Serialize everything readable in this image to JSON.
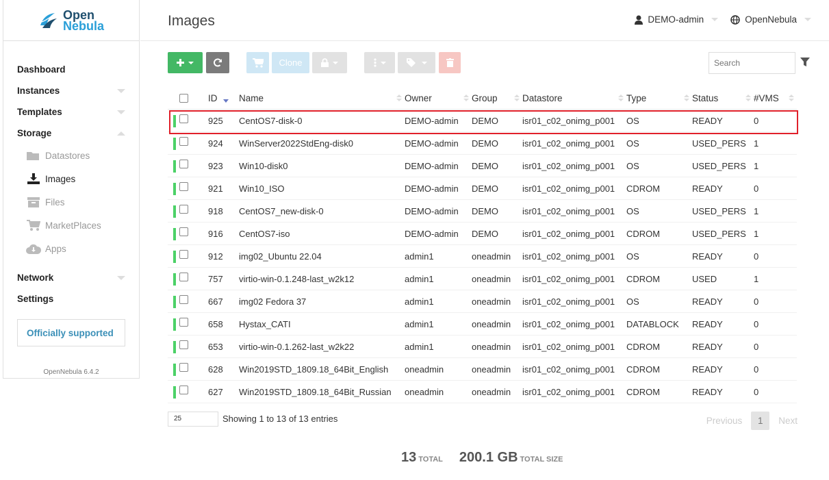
{
  "app": {
    "logo_line1": "Open",
    "logo_line2": "Nebula",
    "version": "OpenNebula 6.4.2"
  },
  "sidebar": {
    "items": [
      {
        "label": "Dashboard"
      },
      {
        "label": "Instances"
      },
      {
        "label": "Templates"
      },
      {
        "label": "Storage"
      }
    ],
    "storage_sub": [
      {
        "label": "Datastores",
        "icon": "folder-icon"
      },
      {
        "label": "Images",
        "icon": "download-icon"
      },
      {
        "label": "Files",
        "icon": "archive-icon"
      },
      {
        "label": "MarketPlaces",
        "icon": "cart-icon"
      },
      {
        "label": "Apps",
        "icon": "cloud-download-icon"
      }
    ],
    "items2": [
      {
        "label": "Network"
      },
      {
        "label": "Settings"
      }
    ],
    "support": "Officially supported"
  },
  "header": {
    "title": "Images",
    "user": "DEMO-admin",
    "zone": "OpenNebula"
  },
  "toolbar": {
    "clone_label": "Clone",
    "search_placeholder": "Search"
  },
  "table": {
    "columns": [
      "ID",
      "Name",
      "Owner",
      "Group",
      "Datastore",
      "Type",
      "Status",
      "#VMS"
    ],
    "rows": [
      [
        "925",
        "CentOS7-disk-0",
        "DEMO-admin",
        "DEMO",
        "isr01_c02_onimg_p001",
        "OS",
        "READY",
        "0"
      ],
      [
        "924",
        "WinServer2022StdEng-disk0",
        "DEMO-admin",
        "DEMO",
        "isr01_c02_onimg_p001",
        "OS",
        "USED_PERS",
        "1"
      ],
      [
        "923",
        "Win10-disk0",
        "DEMO-admin",
        "DEMO",
        "isr01_c02_onimg_p001",
        "OS",
        "USED_PERS",
        "1"
      ],
      [
        "921",
        "Win10_ISO",
        "DEMO-admin",
        "DEMO",
        "isr01_c02_onimg_p001",
        "CDROM",
        "READY",
        "0"
      ],
      [
        "918",
        "CentOS7_new-disk-0",
        "DEMO-admin",
        "DEMO",
        "isr01_c02_onimg_p001",
        "OS",
        "USED_PERS",
        "1"
      ],
      [
        "916",
        "CentOS7-iso",
        "DEMO-admin",
        "DEMO",
        "isr01_c02_onimg_p001",
        "CDROM",
        "USED_PERS",
        "1"
      ],
      [
        "912",
        "img02_Ubuntu 22.04",
        "admin1",
        "oneadmin",
        "isr01_c02_onimg_p001",
        "OS",
        "READY",
        "0"
      ],
      [
        "757",
        "virtio-win-0.1.248-last_w2k12",
        "admin1",
        "oneadmin",
        "isr01_c02_onimg_p001",
        "CDROM",
        "USED",
        "1"
      ],
      [
        "667",
        "img02 Fedora 37",
        "admin1",
        "oneadmin",
        "isr01_c02_onimg_p001",
        "OS",
        "READY",
        "0"
      ],
      [
        "658",
        "Hystax_CATI",
        "admin1",
        "oneadmin",
        "isr01_c02_onimg_p001",
        "DATABLOCK",
        "READY",
        "0"
      ],
      [
        "653",
        "virtio-win-0.1.262-last_w2k22",
        "admin1",
        "oneadmin",
        "isr01_c02_onimg_p001",
        "CDROM",
        "READY",
        "0"
      ],
      [
        "628",
        "Win2019STD_1809.18_64Bit_English",
        "oneadmin",
        "oneadmin",
        "isr01_c02_onimg_p001",
        "CDROM",
        "READY",
        "0"
      ],
      [
        "627",
        "Win2019STD_1809.18_64Bit_Russian",
        "oneadmin",
        "oneadmin",
        "isr01_c02_onimg_p001",
        "CDROM",
        "READY",
        "0"
      ]
    ]
  },
  "footer": {
    "page_size": "25",
    "showing": "Showing 1 to 13 of 13 entries",
    "previous": "Previous",
    "page": "1",
    "next": "Next"
  },
  "totals": {
    "count": "13",
    "count_label": "TOTAL",
    "size": "200.1 GB",
    "size_label": "TOTAL SIZE"
  },
  "colors": {
    "accent_green": "#43b865",
    "state_ready": "#4cd167",
    "highlight": "#e0202a"
  }
}
